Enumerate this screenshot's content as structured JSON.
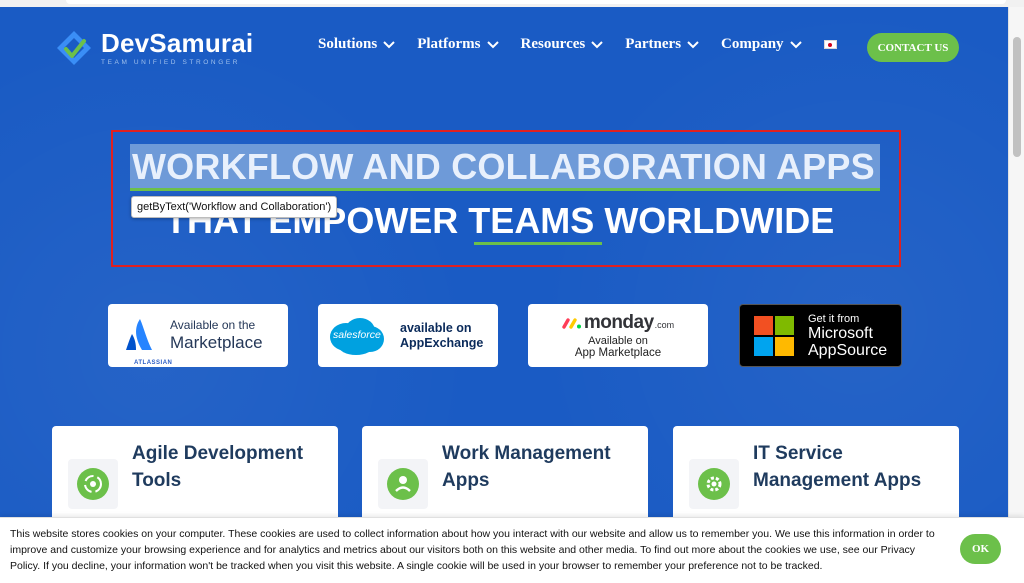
{
  "header": {
    "logo_name": "DevSamurai",
    "logo_tagline": "TEAM UNIFIED STRONGER",
    "nav": [
      {
        "label": "Solutions"
      },
      {
        "label": "Platforms"
      },
      {
        "label": "Resources"
      },
      {
        "label": "Partners"
      },
      {
        "label": "Company"
      }
    ],
    "language_icon": "japan-flag-icon",
    "contact_label": "CONTACT US"
  },
  "hero": {
    "line1": "WORKFLOW AND COLLABORATION APPS",
    "line2": "THAT EMPOWER TEAMS WORLDWIDE",
    "tooltip": "getByText('Workflow and Collaboration')"
  },
  "badges": {
    "atlassian": {
      "small": "Available on the",
      "big": "Marketplace",
      "brand": "ATLASSIAN"
    },
    "salesforce": {
      "brand": "salesforce",
      "line1": "available on",
      "line2": "AppExchange"
    },
    "monday": {
      "brand": "monday",
      "suffix": ".com",
      "line1": "Available on",
      "line2": "App Marketplace"
    },
    "microsoft": {
      "line1": "Get it from",
      "line2": "Microsoft",
      "line3": "AppSource"
    }
  },
  "cards": [
    {
      "title": "Agile Development Tools",
      "icon": "agile-cycle-icon"
    },
    {
      "title": "Work Management Apps",
      "icon": "work-management-icon"
    },
    {
      "title": "IT Service Management Apps",
      "icon": "it-service-gear-icon"
    }
  ],
  "cookie": {
    "text": "This website stores cookies on your computer. These cookies are used to collect information about how you interact with our website and allow us to remember you. We use this information in order to improve and customize your browsing experience and for analytics and metrics about our visitors both on this website and other media. To find out more about the cookies we use, see our Privacy Policy. If you decline, your information won't be tracked when you visit this website. A single cookie will be used in your browser to remember your preference not to be tracked.",
    "ok_label": "OK"
  },
  "colors": {
    "page_bg": "#1a5bc4",
    "accent_green": "#6cc04a",
    "highlight_box": "#e02020"
  }
}
